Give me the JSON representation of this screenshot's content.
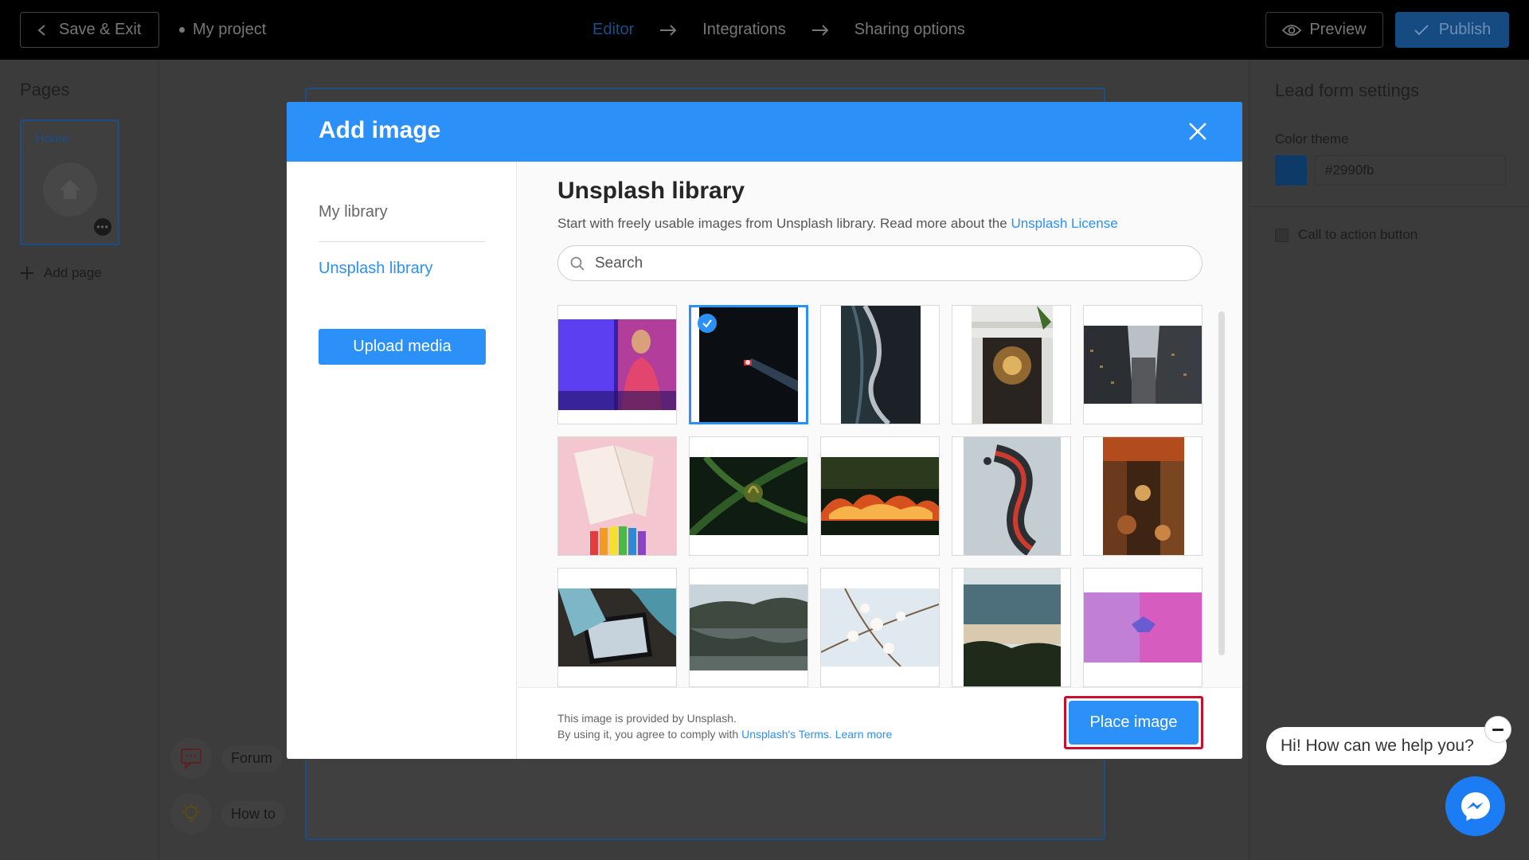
{
  "topbar": {
    "save_exit": "Save & Exit",
    "project_name": "My project",
    "steps": [
      "Editor",
      "Integrations",
      "Sharing options"
    ],
    "preview": "Preview",
    "publish": "Publish"
  },
  "pages_panel": {
    "title": "Pages",
    "page_label": "Home",
    "add_page": "Add page"
  },
  "help": {
    "forum": "Forum",
    "howto": "How to"
  },
  "settings": {
    "title": "Lead form settings",
    "color_theme_label": "Color theme",
    "color_value": "#2990fb",
    "swatch_color": "#0d3a66",
    "cta_label": "Call to action button"
  },
  "modal": {
    "title": "Add image",
    "side": {
      "my_library": "My library",
      "unsplash_library": "Unsplash library",
      "upload": "Upload media"
    },
    "library_title": "Unsplash library",
    "desc_prefix": "Start with freely usable images from Unsplash library. Read more about the",
    "desc_link": "Unsplash License",
    "search_placeholder": "Search",
    "images": [
      {
        "name": "woman-neon-room",
        "selected": false
      },
      {
        "name": "dark-light-beam",
        "selected": true
      },
      {
        "name": "ocean-waves-aerial",
        "selected": false
      },
      {
        "name": "building-chandelier",
        "selected": false
      },
      {
        "name": "skyscrapers-looking-up",
        "selected": false
      },
      {
        "name": "notebook-color-swatches",
        "selected": false
      },
      {
        "name": "fern-leaves",
        "selected": false
      },
      {
        "name": "fire-night",
        "selected": false
      },
      {
        "name": "chrome-sculpture",
        "selected": false
      },
      {
        "name": "market-stalls",
        "selected": false
      },
      {
        "name": "tablet-drawing",
        "selected": false
      },
      {
        "name": "lake-forest-reflection",
        "selected": false
      },
      {
        "name": "white-blossoms",
        "selected": false
      },
      {
        "name": "beach-aerial",
        "selected": false
      },
      {
        "name": "paper-boat-pink",
        "selected": false
      }
    ],
    "footer_line1": "This image is provided by Unsplash.",
    "footer_line2_prefix": "By using it, you agree to comply with",
    "footer_terms": "Unsplash's Terms.",
    "footer_learn": "Learn more",
    "place_image": "Place image"
  },
  "chat": {
    "message": "Hi! How can we help you?"
  },
  "colors": {
    "accent": "#2b90f7",
    "highlight": "#c8102e",
    "messenger": "#1b7cf4"
  }
}
